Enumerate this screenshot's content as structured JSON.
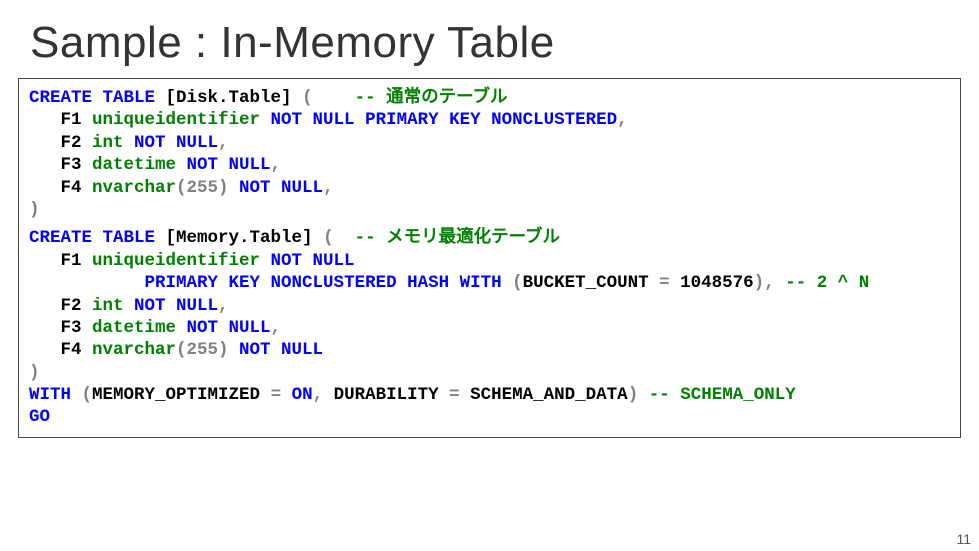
{
  "title": "Sample : In-Memory Table",
  "page_number": "11",
  "code": {
    "disk": {
      "create": "CREATE TABLE",
      "name": " [Disk.Table] ",
      "paren_open": "(    ",
      "comment": "-- 通常のテーブル",
      "f1_col": "   F1 ",
      "f1_type": "uniqueidentifier",
      "f1_opts": " NOT NULL PRIMARY KEY NONCLUSTERED",
      "f1_comma": ",",
      "f2_col": "   F2 ",
      "f2_type": "int",
      "f2_opts": " NOT NULL",
      "f2_comma": ",",
      "f3_col": "   F3 ",
      "f3_type": "datetime",
      "f3_opts": " NOT NULL",
      "f3_comma": ",",
      "f4_col": "   F4 ",
      "f4_type": "nvarchar",
      "f4_size": "(255)",
      "f4_opts": " NOT NULL",
      "f4_comma": ",",
      "close": ")"
    },
    "memory": {
      "create": "CREATE TABLE",
      "name": " [Memory.Table] ",
      "paren_open": "(  ",
      "comment": "-- メモリ最適化テーブル",
      "f1_col": "   F1 ",
      "f1_type": "uniqueidentifier",
      "f1_opts": " NOT NULL",
      "pk_indent": "           ",
      "pk": "PRIMARY KEY NONCLUSTERED HASH WITH ",
      "bucket_open": "(",
      "bucket_key": "BUCKET_COUNT",
      "bucket_eq": " = ",
      "bucket_val": "1048576",
      "bucket_close": ")",
      "f1_comma": ", ",
      "pk_comment": "-- 2 ^ N",
      "f2_col": "   F2 ",
      "f2_type": "int",
      "f2_opts": " NOT NULL",
      "f2_comma": ",",
      "f3_col": "   F3 ",
      "f3_type": "datetime",
      "f3_opts": " NOT NULL",
      "f3_comma": ",",
      "f4_col": "   F4 ",
      "f4_type": "nvarchar",
      "f4_size": "(255)",
      "f4_opts": " NOT NULL",
      "close": ")",
      "with_kw": "WITH ",
      "with_open": "(",
      "opt1_key": "MEMORY_OPTIMIZED",
      "opt1_eq": " = ",
      "opt1_val": "ON",
      "opt_sep": ", ",
      "opt2_key": "DURABILITY",
      "opt2_eq": " = ",
      "opt2_val": "SCHEMA_AND_DATA",
      "with_close": ") ",
      "with_comment": "-- SCHEMA_ONLY",
      "go": "GO"
    }
  }
}
